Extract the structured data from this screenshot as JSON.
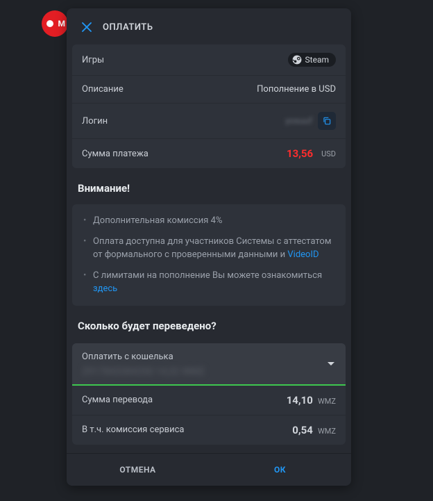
{
  "modal": {
    "title": "ОПЛАТИТЬ"
  },
  "details": {
    "games_label": "Игры",
    "steam_label": "Steam",
    "desc_label": "Описание",
    "desc_value": "Пополнение в USD",
    "login_label": "Логин",
    "login_value": "yosuuf",
    "amount_label": "Сумма платежа",
    "amount_value": "13,56",
    "amount_currency": "USD"
  },
  "notice": {
    "title": "Внимание!",
    "item1": "Дополнительная комиссия 4%",
    "item2a": "Оплата доступна для участников Системы с аттестатом от формального с проверенными данными и ",
    "item2_link": "VideoID",
    "item3a": "С лимитами на пополнение Вы можете ознакомиться ",
    "item3_link": "здесь"
  },
  "transfer": {
    "title": "Сколько будет переведено?",
    "wallet_label": "Оплатить с кошелька",
    "wallet_value": "Z917843384350   14,32 WMZ",
    "sum_label": "Сумма перевода",
    "sum_value": "14,10",
    "sum_currency": "WMZ",
    "fee_label": "В т.ч. комиссия сервиса",
    "fee_value": "0,54",
    "fee_currency": "WMZ"
  },
  "actions": {
    "cancel": "ОТМЕНА",
    "ok": "ОК"
  }
}
